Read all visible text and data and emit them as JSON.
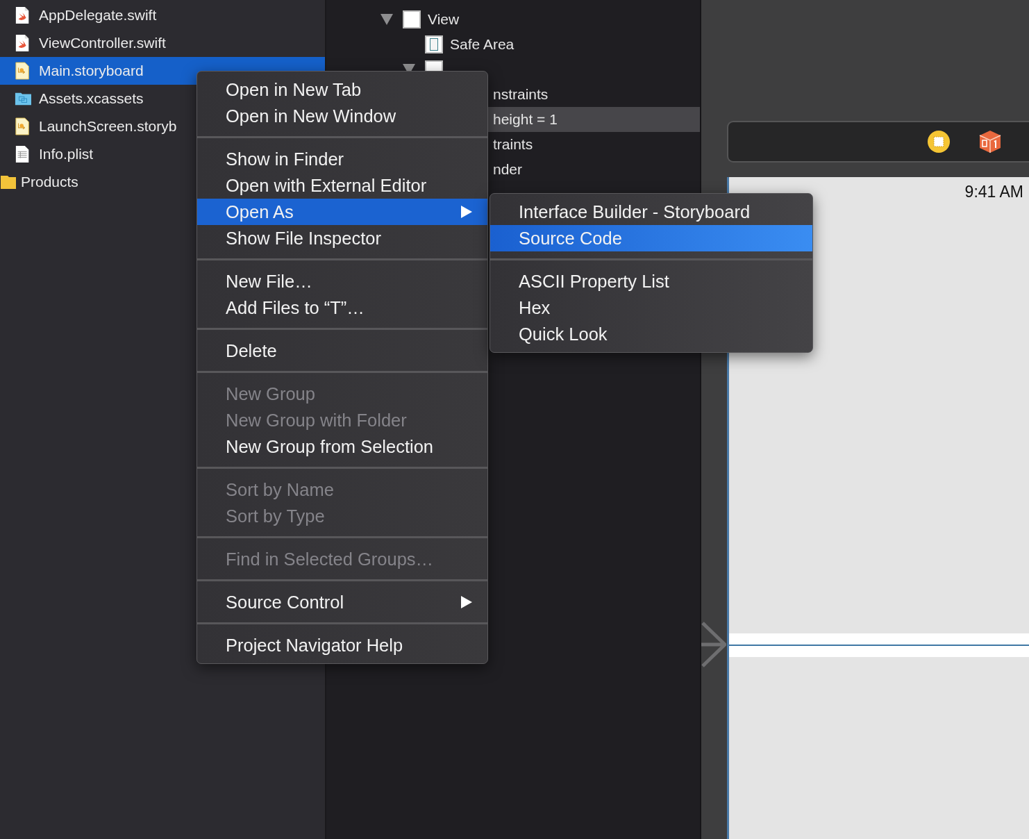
{
  "navigator": {
    "items": [
      {
        "name": "AppDelegate.swift",
        "kind": "swift",
        "selected": false
      },
      {
        "name": "ViewController.swift",
        "kind": "swift",
        "selected": false
      },
      {
        "name": "Main.storyboard",
        "kind": "storyboard",
        "selected": true
      },
      {
        "name": "Assets.xcassets",
        "kind": "assets",
        "selected": false
      },
      {
        "name": "LaunchScreen.storyb",
        "kind": "storyboard",
        "selected": false
      },
      {
        "name": "Info.plist",
        "kind": "plist",
        "selected": false
      },
      {
        "name": "Products",
        "kind": "folder",
        "selected": false
      }
    ]
  },
  "outline": {
    "rows": [
      {
        "label": "View",
        "kind": "view",
        "expanded": true,
        "selected": false,
        "children": [
          {
            "label": "Safe Area",
            "kind": "safe-area",
            "selected": false
          },
          {
            "kind": "view",
            "expanded": true,
            "children": [
              {
                "label": "nstraints",
                "kind": "item",
                "selected": false
              },
              {
                "label": "height = 1",
                "kind": "item",
                "selected": true
              },
              {
                "label": "traints",
                "kind": "item",
                "selected": false
              },
              {
                "label": "nder",
                "kind": "item",
                "selected": false
              }
            ]
          }
        ]
      }
    ]
  },
  "context_menu": {
    "groups": [
      [
        {
          "label": "Open in New Tab",
          "disabled": false,
          "selected": false,
          "submenu": false
        },
        {
          "label": "Open in New Window",
          "disabled": false,
          "selected": false,
          "submenu": false
        }
      ],
      [
        {
          "label": "Show in Finder",
          "disabled": false,
          "selected": false,
          "submenu": false
        },
        {
          "label": "Open with External Editor",
          "disabled": false,
          "selected": false,
          "submenu": false
        },
        {
          "label": "Open As",
          "disabled": false,
          "selected": true,
          "submenu": true
        },
        {
          "label": "Show File Inspector",
          "disabled": false,
          "selected": false,
          "submenu": false
        }
      ],
      [
        {
          "label": "New File…",
          "disabled": false,
          "selected": false,
          "submenu": false
        },
        {
          "label": "Add Files to “T”…",
          "disabled": false,
          "selected": false,
          "submenu": false
        }
      ],
      [
        {
          "label": "Delete",
          "disabled": false,
          "selected": false,
          "submenu": false
        }
      ],
      [
        {
          "label": "New Group",
          "disabled": true,
          "selected": false,
          "submenu": false
        },
        {
          "label": "New Group with Folder",
          "disabled": true,
          "selected": false,
          "submenu": false
        },
        {
          "label": "New Group from Selection",
          "disabled": false,
          "selected": false,
          "submenu": false
        }
      ],
      [
        {
          "label": "Sort by Name",
          "disabled": true,
          "selected": false,
          "submenu": false
        },
        {
          "label": "Sort by Type",
          "disabled": true,
          "selected": false,
          "submenu": false
        }
      ],
      [
        {
          "label": "Find in Selected Groups…",
          "disabled": true,
          "selected": false,
          "submenu": false
        }
      ],
      [
        {
          "label": "Source Control",
          "disabled": false,
          "selected": false,
          "submenu": true
        }
      ],
      [
        {
          "label": "Project Navigator Help",
          "disabled": false,
          "selected": false,
          "submenu": false
        }
      ]
    ]
  },
  "submenu": {
    "groups": [
      [
        {
          "label": "Interface Builder - Storyboard",
          "disabled": false,
          "selected": false,
          "submenu": false
        },
        {
          "label": "Source Code",
          "disabled": false,
          "selected": true,
          "submenu": false
        }
      ],
      [
        {
          "label": "ASCII Property List",
          "disabled": false,
          "selected": false,
          "submenu": false
        },
        {
          "label": "Hex",
          "disabled": false,
          "selected": false,
          "submenu": false
        },
        {
          "label": "Quick Look",
          "disabled": false,
          "selected": false,
          "submenu": false
        }
      ]
    ]
  },
  "canvas": {
    "status_time": "9:41 AM"
  }
}
